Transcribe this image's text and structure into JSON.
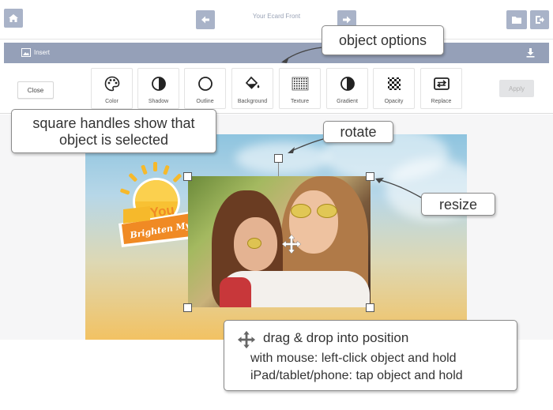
{
  "header": {
    "title": "Your Ecard Front",
    "buttons": [
      "home-icon",
      "back-arrow-icon",
      "forward-arrow-icon",
      "folder-icon",
      "exit-icon"
    ]
  },
  "insert_bar": {
    "label": "Insert",
    "icons": [
      "image-icon",
      "download-icon"
    ]
  },
  "toolbar": {
    "close_label": "Close",
    "apply_label": "Apply",
    "tools": [
      {
        "label": "Color",
        "icon": "palette-icon"
      },
      {
        "label": "Shadow",
        "icon": "shadow-icon"
      },
      {
        "label": "Outline",
        "icon": "outline-circle-icon"
      },
      {
        "label": "Background",
        "icon": "paint-bucket-icon"
      },
      {
        "label": "Texture",
        "icon": "texture-icon"
      },
      {
        "label": "Gradient",
        "icon": "gradient-icon"
      },
      {
        "label": "Opacity",
        "icon": "checkerboard-icon"
      },
      {
        "label": "Replace",
        "icon": "replace-icon"
      }
    ]
  },
  "sticker": {
    "line1": "You",
    "line2": "Brighten My"
  },
  "callouts": {
    "object_options": "object options",
    "handles_line1": "square handles show that",
    "handles_line2": "object is selected",
    "rotate": "rotate",
    "resize": "resize",
    "drag_title": "drag & drop into position",
    "drag_mouse": "with mouse: left-click object and hold",
    "drag_touch": "iPad/tablet/phone: tap object and hold"
  },
  "colors": {
    "button_bg": "#a9b3c8",
    "insert_bar_bg": "#95a0b8",
    "sticker_yellow": "#f6b92b",
    "sticker_orange": "#f08a24"
  }
}
